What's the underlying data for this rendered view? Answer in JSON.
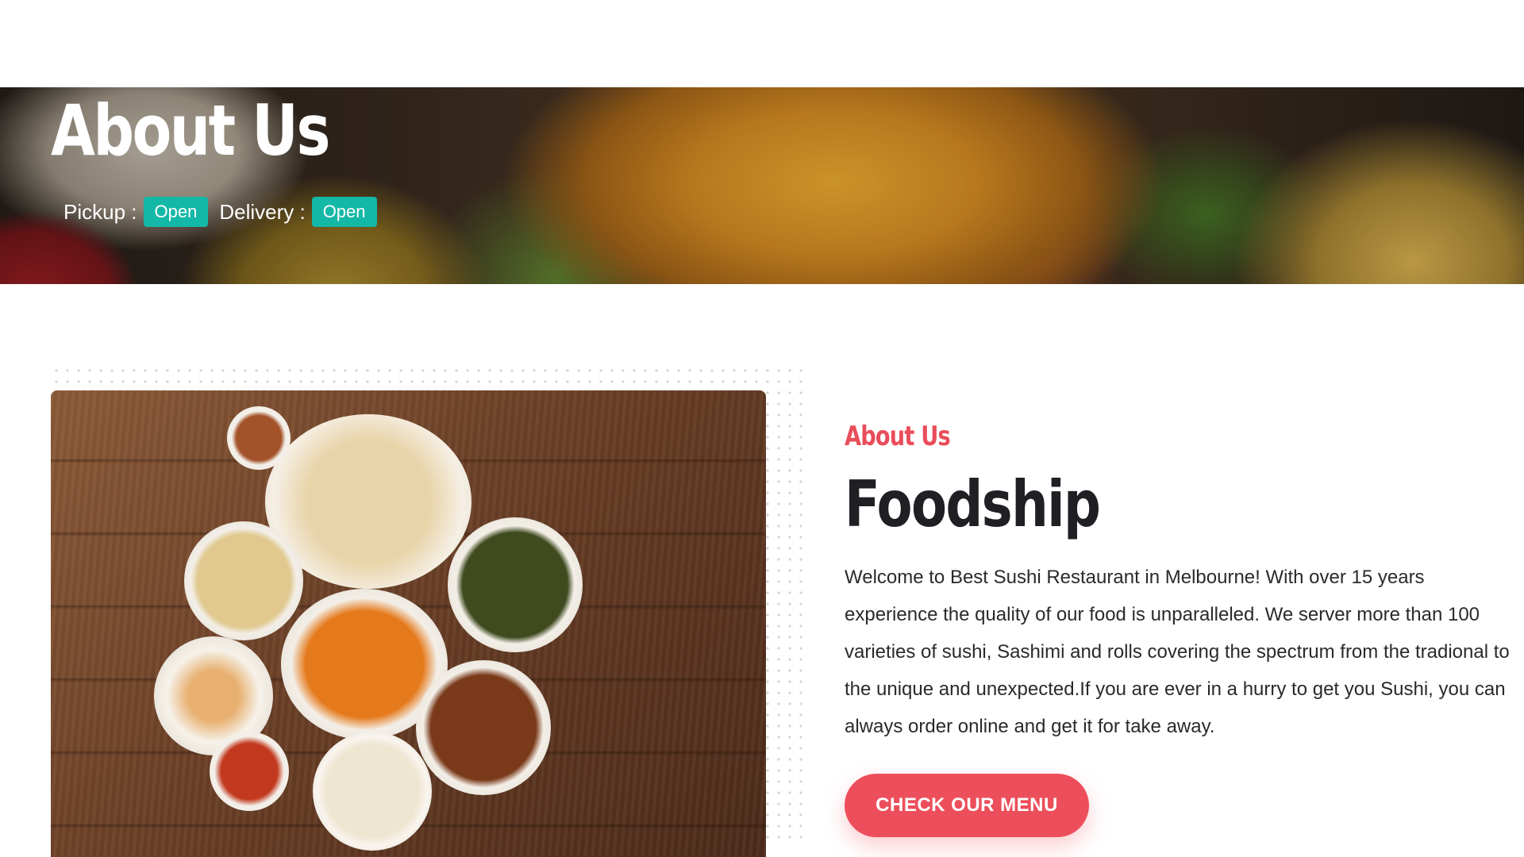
{
  "hero": {
    "title": "About Us",
    "pickup_label": "Pickup :",
    "pickup_status": "Open",
    "delivery_label": "Delivery :",
    "delivery_status": "Open"
  },
  "about": {
    "eyebrow": "About Us",
    "heading": "Foodship",
    "body": "Welcome to Best Sushi Restaurant in Melbourne! With over 15 years experience the quality of our food is unparalleled. We server more than 100 varieties of sushi, Sashimi and rolls covering the spectrum from the tradional to the unique and unexpected.If you are ever in a hurry to get you Sushi, you can always order online and get it for take away.",
    "cta_label": "CHECK OUR MENU"
  },
  "colors": {
    "accent": "#ec4f5b",
    "status_badge": "#14b8a6",
    "heading": "#1f1f24"
  }
}
